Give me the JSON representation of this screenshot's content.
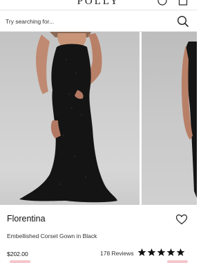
{
  "header": {
    "brand": "POLLY",
    "account_icon": "user-icon",
    "bag_icon": "shopping-bag-icon"
  },
  "search": {
    "placeholder": "Try searching for...",
    "icon": "search-icon"
  },
  "gallery": {
    "images": [
      {
        "subject": "model in strapless black embellished mermaid gown"
      },
      {
        "subject": "model in black gown, partial view"
      }
    ]
  },
  "product": {
    "name": "Florentina",
    "subtitle": "Embellished Corset Gown in Black",
    "price": "$202.00",
    "reviews_label": "178 Reviews",
    "rating": 5,
    "rating_max": 5,
    "wishlist_icon": "heart-icon"
  },
  "colors": {
    "text": "#111111",
    "border": "#e2e2e2",
    "accent": "#f4c6cc"
  }
}
